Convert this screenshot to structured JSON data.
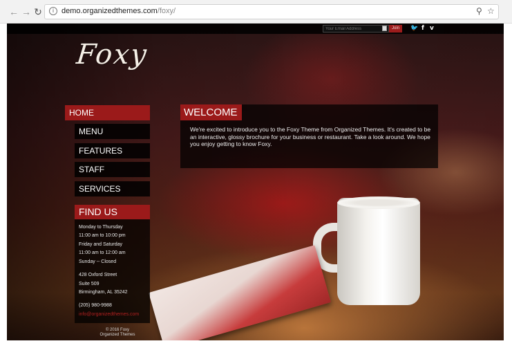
{
  "browser": {
    "url_host": "demo.organizedthemes.com",
    "url_path": "/foxy/"
  },
  "topbar": {
    "email_placeholder": "Your Email Address",
    "join_label": "Join"
  },
  "logo": "Foxy",
  "nav": {
    "home": "HOME",
    "menu": "MENU",
    "features": "FEATURES",
    "staff": "STAFF",
    "services": "SERVICES"
  },
  "findus": {
    "title": "FIND US",
    "hours": [
      "Monday to Thursday",
      "11:00 am to 10:00 pm",
      "Friday and Saturday",
      "11:00 am to 12:00 am",
      "Sunday -- Closed"
    ],
    "address": [
      "428 Oxford Street",
      "Suite 509",
      "Birmingham, AL 35242"
    ],
    "phone": "(205) 980-9988",
    "email": "info@organizedthemes.com"
  },
  "copyright": [
    "© 2016 Foxy",
    "Organized Themes"
  ],
  "welcome": {
    "title": "WELCOME",
    "body": "We're excited to introduce you to the Foxy Theme from Organized Themes. It's created to be an interactive, glossy brochure for your business or restaurant. Take a look around. We hope you enjoy getting to know Foxy."
  },
  "colors": {
    "accent": "#9b1a1a",
    "panel": "#000000"
  }
}
